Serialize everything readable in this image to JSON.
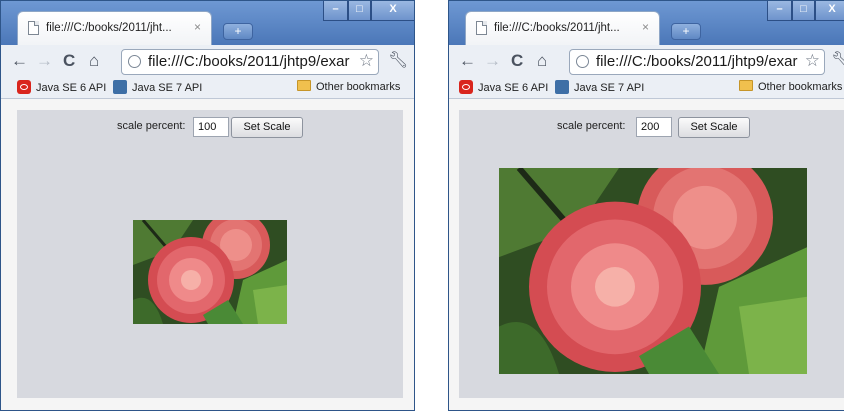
{
  "windows": [
    {
      "tab_title": "file:///C:/books/2011/jht...",
      "tab_close": "×",
      "new_tab": "+",
      "window_controls": {
        "minimize": "–",
        "maximize": "□",
        "close": "X"
      },
      "address": "file:///C:/books/2011/jhtp9/exar",
      "bookmarks": {
        "java6": "Java SE 6 API",
        "java7": "Java SE 7 API",
        "other": "Other bookmarks"
      },
      "applet": {
        "scale_label": "scale percent:",
        "scale_value": "100",
        "button_label": "Set Scale"
      }
    },
    {
      "tab_title": "file:///C:/books/2011/jht...",
      "tab_close": "×",
      "new_tab": "+",
      "window_controls": {
        "minimize": "–",
        "maximize": "□",
        "close": "X"
      },
      "address": "file:///C:/books/2011/jhtp9/exar",
      "bookmarks": {
        "java6": "Java SE 6 API",
        "java7": "Java SE 7 API",
        "other": "Other bookmarks"
      },
      "applet": {
        "scale_label": "scale percent:",
        "scale_value": "200",
        "button_label": "Set Scale"
      }
    }
  ],
  "icons": {
    "back": "back-arrow-icon",
    "forward": "forward-arrow-icon",
    "reload": "reload-icon",
    "home": "home-icon",
    "star": "bookmark-star-icon",
    "wrench": "wrench-icon"
  },
  "colors": {
    "frame": "#4a76b6",
    "toolbar": "#ebeff5",
    "applet_bg": "#d7d9df"
  }
}
